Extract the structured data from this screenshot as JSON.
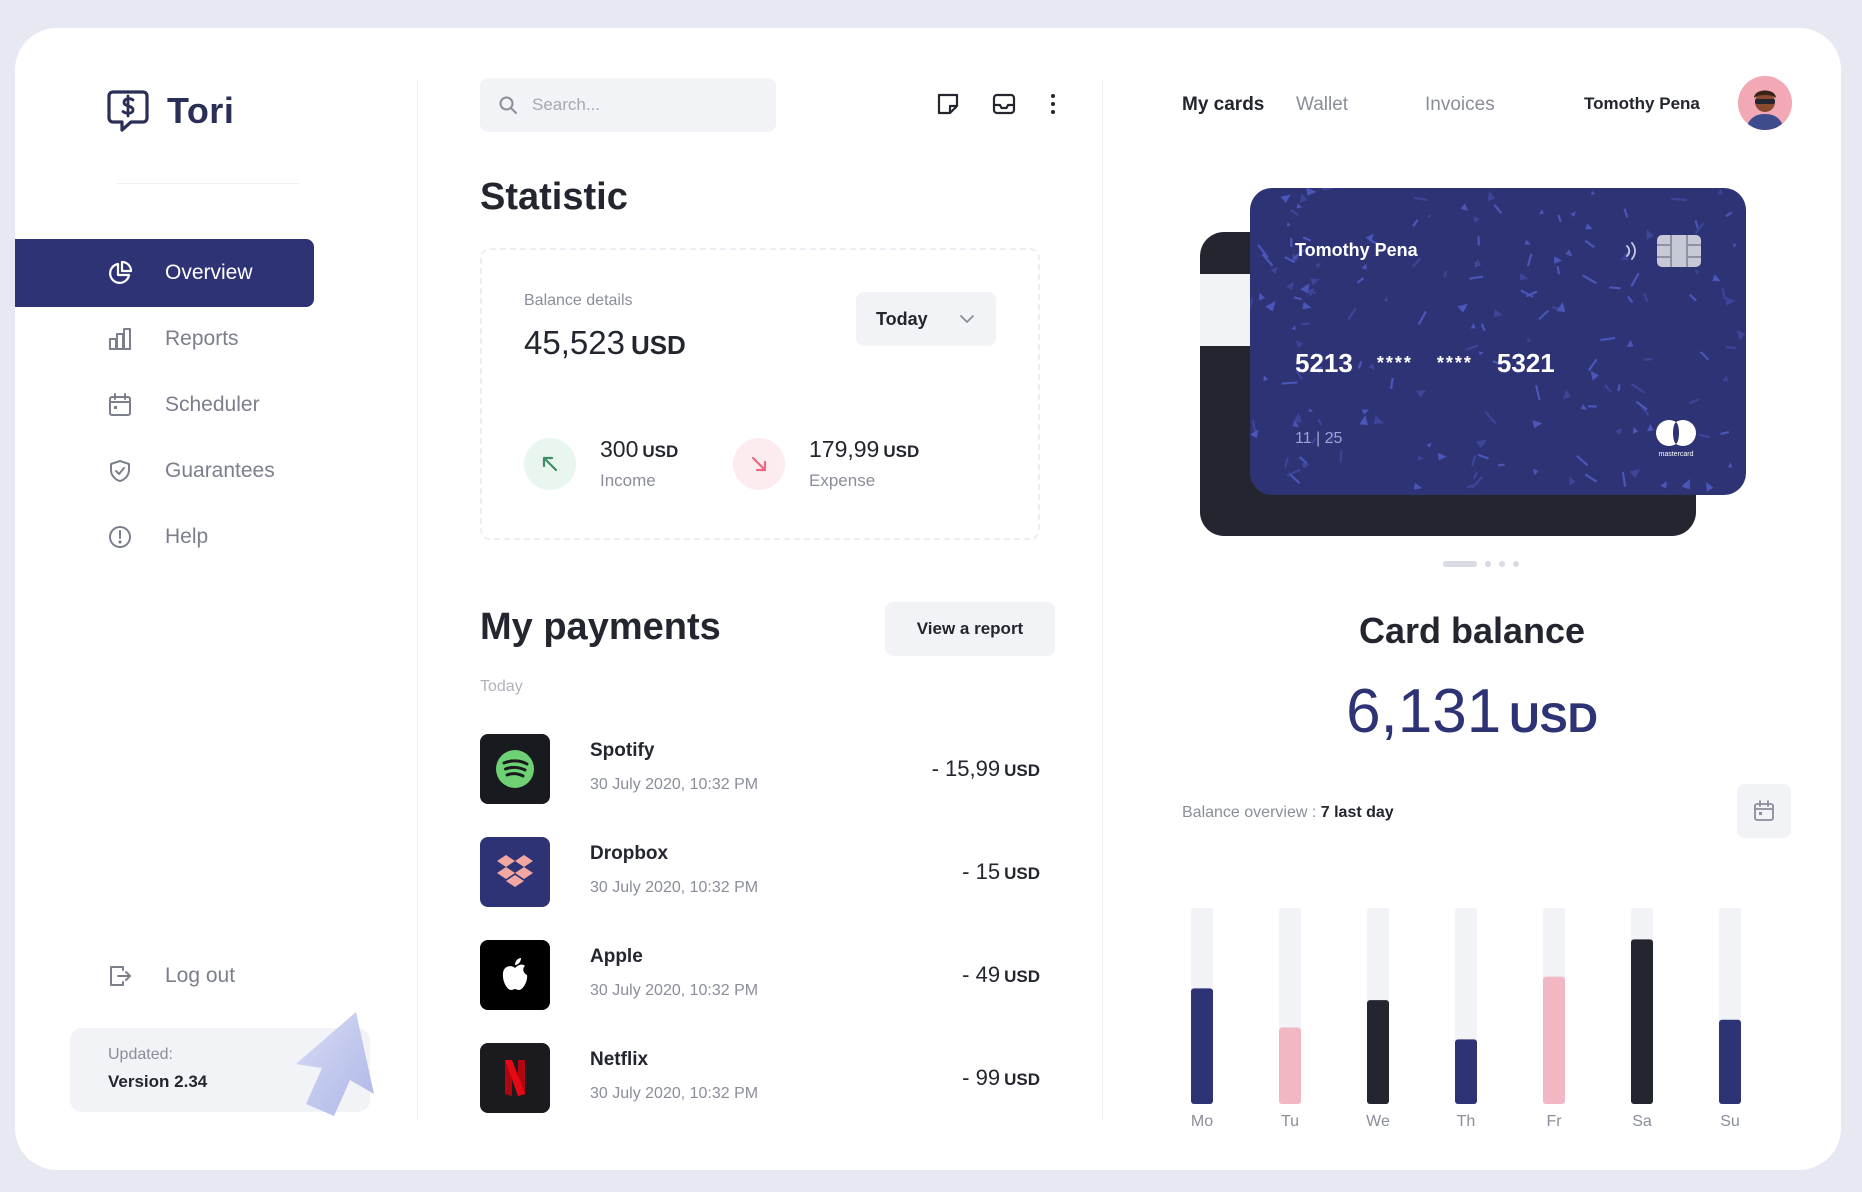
{
  "app": {
    "name": "Tori"
  },
  "sidebar": {
    "items": [
      {
        "label": "Overview",
        "icon": "pie-chart-icon",
        "active": true
      },
      {
        "label": "Reports",
        "icon": "bar-chart-icon",
        "active": false
      },
      {
        "label": "Scheduler",
        "icon": "calendar-icon",
        "active": false
      },
      {
        "label": "Guarantees",
        "icon": "shield-icon",
        "active": false
      },
      {
        "label": "Help",
        "icon": "info-icon",
        "active": false
      }
    ],
    "logout_label": "Log out",
    "update": {
      "label": "Updated:",
      "value": "Version 2.34"
    }
  },
  "search": {
    "placeholder": "Search..."
  },
  "statistic": {
    "title": "Statistic",
    "balance_label": "Balance details",
    "balance_amount": "45,523",
    "balance_unit": "USD",
    "period": "Today",
    "income": {
      "amount": "300",
      "unit": "USD",
      "label": "Income"
    },
    "expense": {
      "amount": "179,99",
      "unit": "USD",
      "label": "Expense"
    }
  },
  "payments": {
    "title": "My payments",
    "report_button": "View a report",
    "group_label": "Today",
    "items": [
      {
        "name": "Spotify",
        "date": "30 July 2020, 10:32 PM",
        "amount": "- 15,99",
        "unit": "USD",
        "icon": "spotify-icon"
      },
      {
        "name": "Dropbox",
        "date": "30 July 2020, 10:32 PM",
        "amount": "- 15",
        "unit": "USD",
        "icon": "dropbox-icon"
      },
      {
        "name": "Apple",
        "date": "30 July 2020, 10:32 PM",
        "amount": "- 49",
        "unit": "USD",
        "icon": "apple-icon"
      },
      {
        "name": "Netflix",
        "date": "30 July 2020, 10:32 PM",
        "amount": "- 99",
        "unit": "USD",
        "icon": "netflix-icon"
      }
    ]
  },
  "header": {
    "tabs": [
      {
        "label": "My cards",
        "active": true
      },
      {
        "label": "Wallet",
        "active": false
      },
      {
        "label": "Invoices",
        "active": false
      }
    ],
    "user_name": "Tomothy Pena"
  },
  "card": {
    "holder": "Tomothy Pena",
    "number_groups": [
      "5213",
      "****",
      "****",
      "5321"
    ],
    "expiry": "11 | 25",
    "brand": "mastercard",
    "pager_count": 4,
    "pager_active": 0
  },
  "balance": {
    "title": "Card balance",
    "amount": "6,131",
    "unit": "USD",
    "overview_label": "Balance overview :",
    "overview_period": "7 last day"
  },
  "colors": {
    "primary": "#2e3375",
    "dark": "#23262f",
    "pink": "#f1b7c3",
    "track": "#f2f3f6",
    "income_bg": "#e8f6ef",
    "income_fg": "#3e8e66",
    "expense_bg": "#fdecef",
    "expense_fg": "#e96a7f"
  },
  "chart_data": {
    "type": "bar",
    "categories": [
      "Mo",
      "Tu",
      "We",
      "Th",
      "Fr",
      "Sa",
      "Su"
    ],
    "values": [
      0.59,
      0.39,
      0.53,
      0.33,
      0.65,
      0.84,
      0.43
    ],
    "bar_colors": [
      "#2e3375",
      "#f1b7c3",
      "#23262f",
      "#2e3375",
      "#f1b7c3",
      "#23262f",
      "#2e3375"
    ],
    "ylim": [
      0,
      1
    ],
    "grid": false
  }
}
